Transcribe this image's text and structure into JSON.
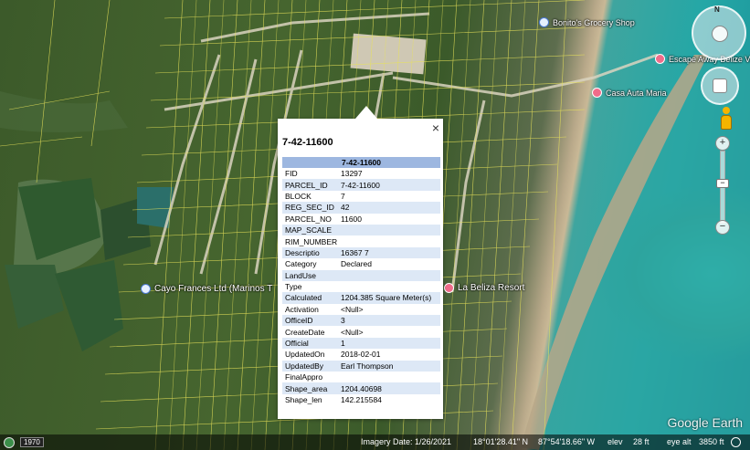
{
  "places": [
    {
      "name": "Bonito's Grocery Shop"
    },
    {
      "name": "Escape Away Belize VRB"
    },
    {
      "name": "Casa Auta Maria"
    },
    {
      "name": "La Beliza Resort"
    },
    {
      "name": "Cayo Frances Ltd (Marinos T"
    }
  ],
  "nav": {
    "north_label": "N"
  },
  "zoom": {
    "plus": "+",
    "minus": "−",
    "knob": "−"
  },
  "popup": {
    "title": "7-42-11600",
    "table_header": "7-42-11600",
    "close": "×",
    "rows": [
      {
        "key": "FID",
        "value": "13297"
      },
      {
        "key": "PARCEL_ID",
        "value": "7-42-11600"
      },
      {
        "key": "BLOCK",
        "value": "7"
      },
      {
        "key": "REG_SEC_ID",
        "value": "42"
      },
      {
        "key": "PARCEL_NO",
        "value": "11600"
      },
      {
        "key": "MAP_SCALE",
        "value": ""
      },
      {
        "key": "RIM_NUMBER",
        "value": ""
      },
      {
        "key": "Descriptio",
        "value": "16367 7"
      },
      {
        "key": "Category",
        "value": "Declared"
      },
      {
        "key": "LandUse",
        "value": ""
      },
      {
        "key": "Type",
        "value": ""
      },
      {
        "key": "Calculated",
        "value": "1204.385 Square Meter(s)"
      },
      {
        "key": "Activation",
        "value": "<Null>"
      },
      {
        "key": "OfficeID",
        "value": "3"
      },
      {
        "key": "CreateDate",
        "value": "<Null>"
      },
      {
        "key": "Official",
        "value": "1"
      },
      {
        "key": "UpdatedOn",
        "value": "2018-02-01"
      },
      {
        "key": "UpdatedBy",
        "value": "Earl Thompson"
      },
      {
        "key": "FinalAppro",
        "value": ""
      },
      {
        "key": "Shape_area",
        "value": "1204.40698"
      },
      {
        "key": "Shape_len",
        "value": "142.215584"
      }
    ]
  },
  "status": {
    "year": "1970",
    "imagery_date": "Imagery Date: 1/26/2021",
    "lat": "18°01'28.41\" N",
    "lon": "87°54'18.66\" W",
    "elev_label": "elev",
    "elev_value": "28 ft",
    "eye_label": "eye alt",
    "eye_value": "3850 ft"
  },
  "logo": "Google Earth",
  "colors": {
    "parcel_line": "#e8e25a",
    "header_blue": "#9db7e0",
    "alt_row": "#dde8f6"
  }
}
